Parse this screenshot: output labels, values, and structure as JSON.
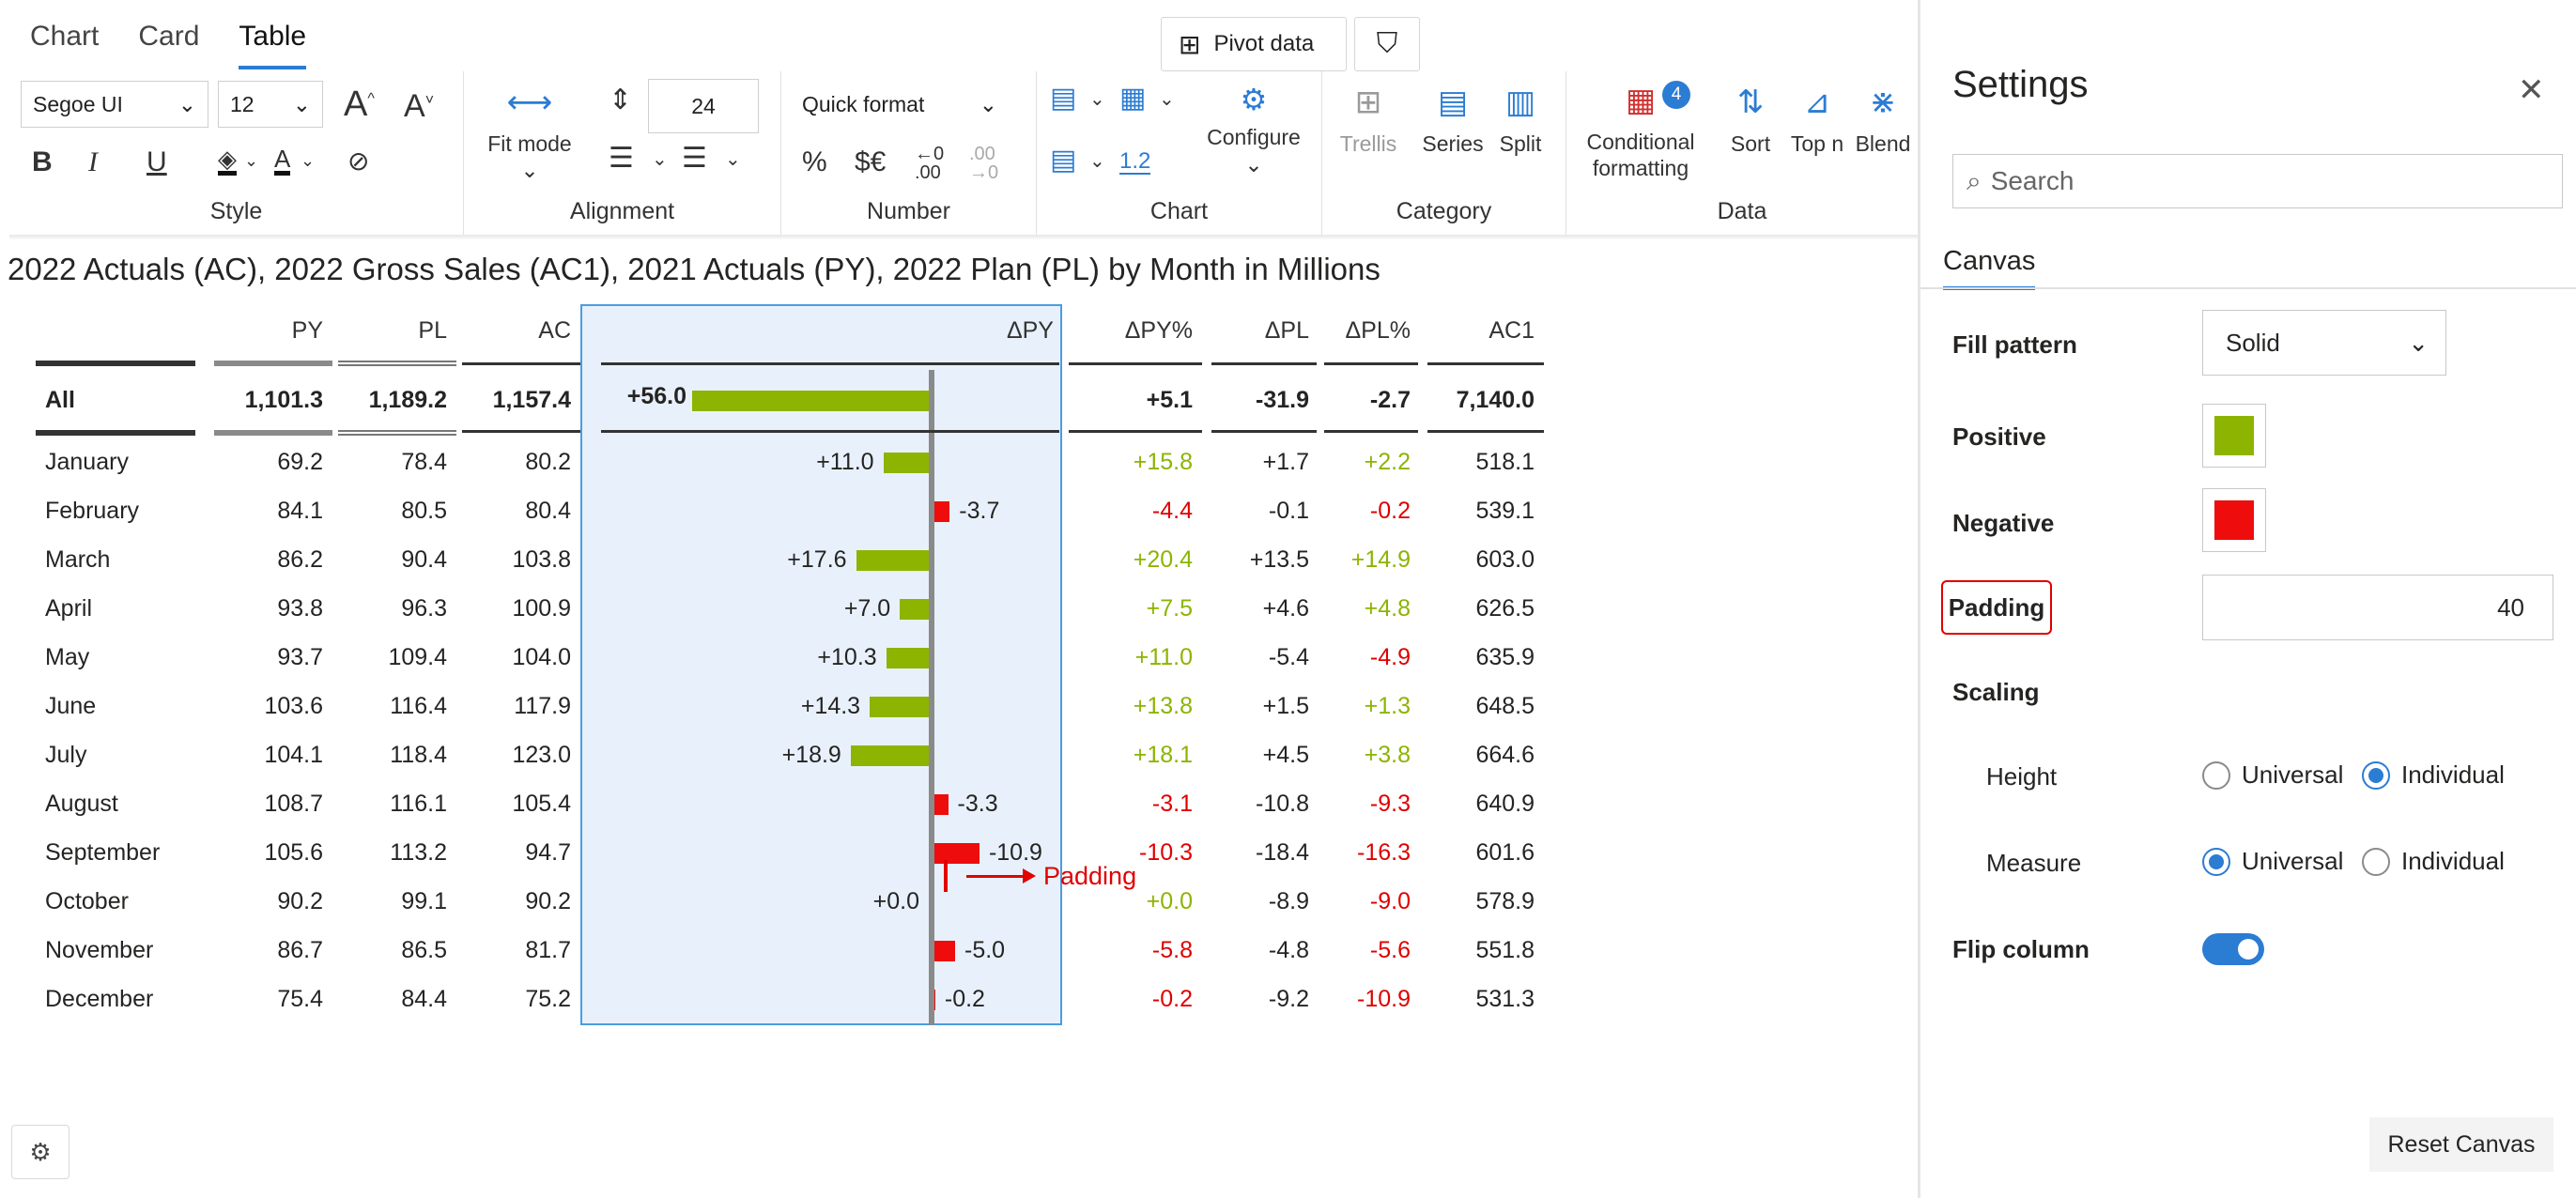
{
  "tabs": [
    "Chart",
    "Card",
    "Table"
  ],
  "toolbar": {
    "pivot_label": "Pivot data",
    "font_name": "Segoe UI",
    "font_size": "12",
    "row_height": "24",
    "quick_format": "Quick format",
    "fit_mode": "Fit mode",
    "configure": "Configure",
    "trellis": "Trellis",
    "series": "Series",
    "split": "Split",
    "conditional_formatting": "Conditional formatting",
    "cf_badge": "4",
    "sort": "Sort",
    "top_n": "Top n",
    "blend": "Blend",
    "decimals": "1.2",
    "groups": {
      "style": "Style",
      "alignment": "Alignment",
      "number": "Number",
      "chart": "Chart",
      "category": "Category",
      "data": "Data"
    }
  },
  "chart_title": "2022 Actuals (AC), 2022 Gross Sales (AC1), 2021 Actuals (PY), 2022 Plan (PL) by Month in Millions",
  "table": {
    "headers": {
      "py": "PY",
      "pl": "PL",
      "ac": "AC",
      "dpy": "ΔPY",
      "dpyp": "ΔPY%",
      "dpl": "ΔPL",
      "dplp": "ΔPL%",
      "ac1": "AC1"
    },
    "total": {
      "label": "All",
      "py": "1,101.3",
      "pl": "1,189.2",
      "ac": "1,157.4",
      "dpy": "+56.0",
      "dpyp": "+5.1",
      "dpl": "-31.9",
      "dplp": "-2.7",
      "ac1": "7,140.0"
    },
    "rows": [
      {
        "label": "January",
        "py": "69.2",
        "pl": "78.4",
        "ac": "80.2",
        "dpy": "+11.0",
        "dpyp": "+15.8",
        "dpl": "+1.7",
        "dplp": "+2.2",
        "ac1": "518.1"
      },
      {
        "label": "February",
        "py": "84.1",
        "pl": "80.5",
        "ac": "80.4",
        "dpy": "-3.7",
        "dpyp": "-4.4",
        "dpl": "-0.1",
        "dplp": "-0.2",
        "ac1": "539.1"
      },
      {
        "label": "March",
        "py": "86.2",
        "pl": "90.4",
        "ac": "103.8",
        "dpy": "+17.6",
        "dpyp": "+20.4",
        "dpl": "+13.5",
        "dplp": "+14.9",
        "ac1": "603.0"
      },
      {
        "label": "April",
        "py": "93.8",
        "pl": "96.3",
        "ac": "100.9",
        "dpy": "+7.0",
        "dpyp": "+7.5",
        "dpl": "+4.6",
        "dplp": "+4.8",
        "ac1": "626.5"
      },
      {
        "label": "May",
        "py": "93.7",
        "pl": "109.4",
        "ac": "104.0",
        "dpy": "+10.3",
        "dpyp": "+11.0",
        "dpl": "-5.4",
        "dplp": "-4.9",
        "ac1": "635.9"
      },
      {
        "label": "June",
        "py": "103.6",
        "pl": "116.4",
        "ac": "117.9",
        "dpy": "+14.3",
        "dpyp": "+13.8",
        "dpl": "+1.5",
        "dplp": "+1.3",
        "ac1": "648.5"
      },
      {
        "label": "July",
        "py": "104.1",
        "pl": "118.4",
        "ac": "123.0",
        "dpy": "+18.9",
        "dpyp": "+18.1",
        "dpl": "+4.5",
        "dplp": "+3.8",
        "ac1": "664.6"
      },
      {
        "label": "August",
        "py": "108.7",
        "pl": "116.1",
        "ac": "105.4",
        "dpy": "-3.3",
        "dpyp": "-3.1",
        "dpl": "-10.8",
        "dplp": "-9.3",
        "ac1": "640.9"
      },
      {
        "label": "September",
        "py": "105.6",
        "pl": "113.2",
        "ac": "94.7",
        "dpy": "-10.9",
        "dpyp": "-10.3",
        "dpl": "-18.4",
        "dplp": "-16.3",
        "ac1": "601.6"
      },
      {
        "label": "October",
        "py": "90.2",
        "pl": "99.1",
        "ac": "90.2",
        "dpy": "+0.0",
        "dpyp": "+0.0",
        "dpl": "-8.9",
        "dplp": "-9.0",
        "ac1": "578.9"
      },
      {
        "label": "November",
        "py": "86.7",
        "pl": "86.5",
        "ac": "81.7",
        "dpy": "-5.0",
        "dpyp": "-5.8",
        "dpl": "-4.8",
        "dplp": "-5.6",
        "ac1": "551.8"
      },
      {
        "label": "December",
        "py": "75.4",
        "pl": "84.4",
        "ac": "75.2",
        "dpy": "-0.2",
        "dpyp": "-0.2",
        "dpl": "-9.2",
        "dplp": "-10.9",
        "ac1": "531.3"
      }
    ]
  },
  "annotation": {
    "padding_label": "Padding"
  },
  "colors": {
    "positive": "#8cb400",
    "negative": "#ee0c0c",
    "accent": "#2b7cd3"
  },
  "settings": {
    "title": "Settings",
    "search_placeholder": "Search",
    "section_tab": "Canvas",
    "fill_pattern_label": "Fill pattern",
    "fill_pattern_value": "Solid",
    "positive_label": "Positive",
    "negative_label": "Negative",
    "padding_label": "Padding",
    "padding_value": "40",
    "scaling_label": "Scaling",
    "height_label": "Height",
    "measure_label": "Measure",
    "universal": "Universal",
    "individual": "Individual",
    "flip_column_label": "Flip column",
    "flip_column_on": true,
    "reset_label": "Reset Canvas"
  }
}
